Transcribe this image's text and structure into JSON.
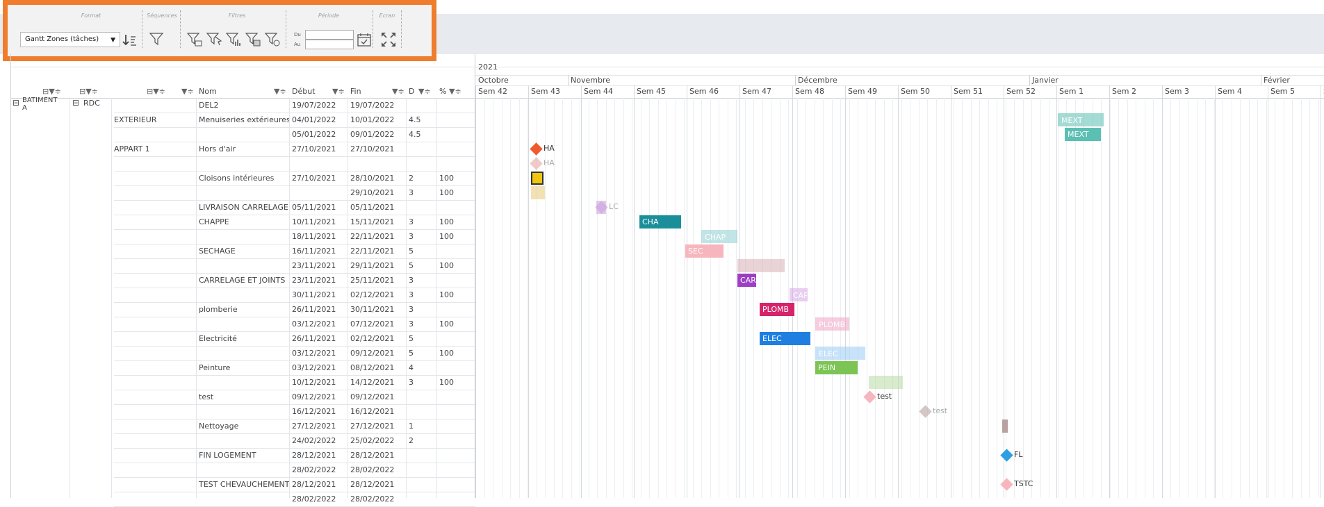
{
  "toolbar": {
    "groups": {
      "format": "Format",
      "sequences": "Séquences",
      "filtres": "Filtres",
      "periode": "Période",
      "ecran": "Ecran"
    },
    "format_value": "Gantt Zones (tâches)",
    "period_from_label": "Du",
    "period_to_label": "Au",
    "icons": [
      "sort-icon",
      "filter-icon",
      "filter-zone-icon",
      "filter-select-icon",
      "filter-chart-icon",
      "filter-grid-icon",
      "filter-clear-icon",
      "calendar-check-icon",
      "fullscreen-icon"
    ],
    "accent": "#ef7d2d"
  },
  "columns": {
    "nom": "Nom",
    "debut": "Début",
    "fin": "Fin",
    "d": "D",
    "pct": "%"
  },
  "tree": {
    "building": "BATIMENT A",
    "level": "RDC"
  },
  "rows": [
    {
      "zone": "",
      "nom": "DEL2",
      "debut": "19/07/2022",
      "fin": "19/07/2022",
      "d": "",
      "pct": ""
    },
    {
      "zone": "EXTERIEUR",
      "nom": "Menuiseries extérieures",
      "debut": "04/01/2022",
      "fin": "10/01/2022",
      "d": "4.5",
      "pct": ""
    },
    {
      "zone": "",
      "nom": "",
      "debut": "05/01/2022",
      "fin": "09/01/2022",
      "d": "4.5",
      "pct": ""
    },
    {
      "zone": "APPART 1",
      "nom": "Hors d'air",
      "debut": "27/10/2021",
      "fin": "27/10/2021",
      "d": "",
      "pct": ""
    },
    {
      "zone": "",
      "nom": "",
      "debut": "",
      "fin": "",
      "d": "",
      "pct": ""
    },
    {
      "zone": "",
      "nom": "Cloisons intérieures",
      "debut": "27/10/2021",
      "fin": "28/10/2021",
      "d": "2",
      "pct": "100"
    },
    {
      "zone": "",
      "nom": "",
      "debut": "",
      "fin": "29/10/2021",
      "d": "3",
      "pct": "100"
    },
    {
      "zone": "",
      "nom": "LIVRAISON CARRELAGE",
      "debut": "05/11/2021",
      "fin": "05/11/2021",
      "d": "",
      "pct": ""
    },
    {
      "zone": "",
      "nom": "CHAPPE",
      "debut": "10/11/2021",
      "fin": "15/11/2021",
      "d": "3",
      "pct": "100"
    },
    {
      "zone": "",
      "nom": "",
      "debut": "18/11/2021",
      "fin": "22/11/2021",
      "d": "3",
      "pct": "100"
    },
    {
      "zone": "",
      "nom": "SECHAGE",
      "debut": "16/11/2021",
      "fin": "22/11/2021",
      "d": "5",
      "pct": ""
    },
    {
      "zone": "",
      "nom": "",
      "debut": "23/11/2021",
      "fin": "29/11/2021",
      "d": "5",
      "pct": "100"
    },
    {
      "zone": "",
      "nom": "CARRELAGE ET JOINTS",
      "debut": "23/11/2021",
      "fin": "25/11/2021",
      "d": "3",
      "pct": ""
    },
    {
      "zone": "",
      "nom": "",
      "debut": "30/11/2021",
      "fin": "02/12/2021",
      "d": "3",
      "pct": "100"
    },
    {
      "zone": "",
      "nom": "plomberie",
      "debut": "26/11/2021",
      "fin": "30/11/2021",
      "d": "3",
      "pct": ""
    },
    {
      "zone": "",
      "nom": "",
      "debut": "03/12/2021",
      "fin": "07/12/2021",
      "d": "3",
      "pct": "100"
    },
    {
      "zone": "",
      "nom": "Electricité",
      "debut": "26/11/2021",
      "fin": "02/12/2021",
      "d": "5",
      "pct": ""
    },
    {
      "zone": "",
      "nom": "",
      "debut": "03/12/2021",
      "fin": "09/12/2021",
      "d": "5",
      "pct": "100"
    },
    {
      "zone": "",
      "nom": "Peinture",
      "debut": "03/12/2021",
      "fin": "08/12/2021",
      "d": "4",
      "pct": ""
    },
    {
      "zone": "",
      "nom": "",
      "debut": "10/12/2021",
      "fin": "14/12/2021",
      "d": "3",
      "pct": "100"
    },
    {
      "zone": "",
      "nom": "test",
      "debut": "09/12/2021",
      "fin": "09/12/2021",
      "d": "",
      "pct": ""
    },
    {
      "zone": "",
      "nom": "",
      "debut": "16/12/2021",
      "fin": "16/12/2021",
      "d": "",
      "pct": ""
    },
    {
      "zone": "",
      "nom": "Nettoyage",
      "debut": "27/12/2021",
      "fin": "27/12/2021",
      "d": "1",
      "pct": ""
    },
    {
      "zone": "",
      "nom": "",
      "debut": "24/02/2022",
      "fin": "25/02/2022",
      "d": "2",
      "pct": ""
    },
    {
      "zone": "",
      "nom": "FIN LOGEMENT",
      "debut": "28/12/2021",
      "fin": "28/12/2021",
      "d": "",
      "pct": ""
    },
    {
      "zone": "",
      "nom": "",
      "debut": "28/02/2022",
      "fin": "28/02/2022",
      "d": "",
      "pct": ""
    },
    {
      "zone": "",
      "nom": "TEST CHEVAUCHEMENT",
      "debut": "28/12/2021",
      "fin": "28/12/2021",
      "d": "",
      "pct": ""
    },
    {
      "zone": "",
      "nom": "",
      "debut": "28/02/2022",
      "fin": "28/02/2022",
      "d": "",
      "pct": ""
    }
  ],
  "timeline": {
    "year": "2021",
    "months": [
      "Octobre",
      "Novembre",
      "Décembre",
      "Janvier",
      "Février"
    ],
    "weeks": [
      "Sem 42",
      "Sem 43",
      "Sem 44",
      "Sem 45",
      "Sem 46",
      "Sem 47",
      "Sem 48",
      "Sem 49",
      "Sem 50",
      "Sem 51",
      "Sem 52",
      "Sem 1",
      "Sem 2",
      "Sem 3",
      "Sem 4",
      "Sem 5",
      "Sem"
    ]
  },
  "gantt": {
    "bars": [
      {
        "label": "MEXT",
        "color": "#5bbfb2",
        "faded": true
      },
      {
        "label": "MEXT",
        "color": "#5bbfb2",
        "faded": false
      },
      {
        "label": "",
        "color": "#f1c40f",
        "faded": false
      },
      {
        "label": "",
        "color": "#e8c97a",
        "faded": true
      },
      {
        "label": "",
        "color": "#c9a0dc",
        "faded": true
      },
      {
        "label": "CHA",
        "color": "#1a8f9a",
        "faded": false
      },
      {
        "label": "CHAP",
        "color": "#8fcfd2",
        "faded": true
      },
      {
        "label": "SEC",
        "color": "#f7b6bd",
        "faded": false
      },
      {
        "label": "",
        "color": "#d9b0b5",
        "faded": true
      },
      {
        "label": "CAR",
        "color": "#9b3fc4",
        "faded": false
      },
      {
        "label": "CAR",
        "color": "#d8a7e6",
        "faded": true
      },
      {
        "label": "PLOMB",
        "color": "#d6246a",
        "faded": false
      },
      {
        "label": "PLOMB",
        "color": "#f0a3c4",
        "faded": true
      },
      {
        "label": "ELEC",
        "color": "#1f7fe0",
        "faded": false
      },
      {
        "label": "ELEC",
        "color": "#9ccdf5",
        "faded": true
      },
      {
        "label": "PEIN",
        "color": "#7cc453",
        "faded": false
      },
      {
        "label": "",
        "color": "#b9dba6",
        "faded": true
      },
      {
        "label": "",
        "color": "#b8a2a2",
        "faded": false
      }
    ],
    "milestones": [
      {
        "label": "HA",
        "color": "#ef5a2d",
        "faded": false
      },
      {
        "label": "HA",
        "color": "#e6a6a6",
        "faded": true
      },
      {
        "label": "LC",
        "color": "#c9a0dc",
        "faded": true
      },
      {
        "label": "test",
        "color": "#f7b6bd",
        "faded": false
      },
      {
        "label": "test",
        "color": "#b8a2a2",
        "faded": true
      },
      {
        "label": "FL",
        "color": "#2e9fe0",
        "faded": false
      },
      {
        "label": "TSTC",
        "color": "#f7b6bd",
        "faded": false
      }
    ]
  }
}
